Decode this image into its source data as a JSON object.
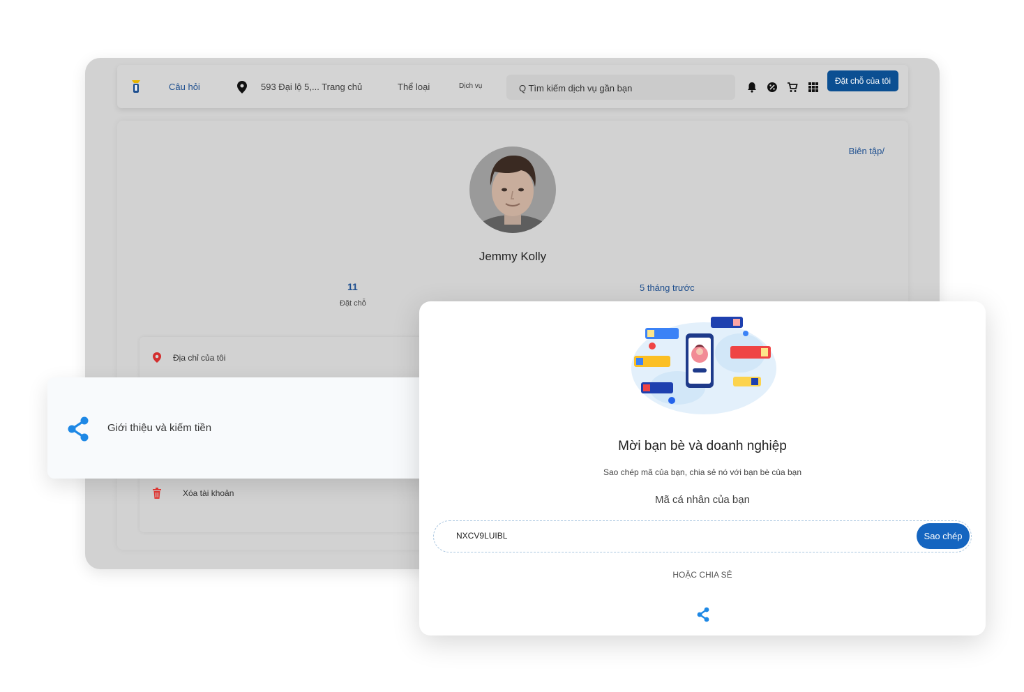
{
  "header": {
    "faq_link": "Câu hỏi",
    "address": "593 Đại lộ 5,... Trang chủ",
    "category_menu": "Thể loại",
    "service_menu": "Dịch vụ",
    "search_placeholder": "Q Tìm kiếm dịch vụ gần bạn",
    "my_bookings_button": "Đặt chỗ của tôi"
  },
  "profile": {
    "edit_link": "Biên tập/",
    "name": "Jemmy Kolly",
    "bookings_count": "11",
    "bookings_label": "Đặt chỗ",
    "member_since": "5 tháng trước"
  },
  "menu": {
    "my_address": "Địa chỉ của tôi",
    "referral": "Giới thiệu và kiếm tiền",
    "delete_account": "Xóa tài khoản"
  },
  "invite": {
    "title": "Mời bạn bè và doanh nghiệp",
    "subtitle": "Sao chép mã của bạn, chia sẻ nó với bạn bè của bạn",
    "code_label": "Mã cá nhân của bạn",
    "code_value": "NXCV9LUIBL",
    "copy_button": "Sao chép",
    "or_share": "HOẶC CHIA SẺ"
  },
  "colors": {
    "brand_blue": "#0b4f92",
    "button_blue": "#1565c0",
    "share_blue": "#1e88e5",
    "delete_red": "#e53935",
    "pin_red": "#d32f2f"
  },
  "icons": {
    "location": "map-pin-icon",
    "notifications": "bell-icon",
    "offers": "badge-icon",
    "cart": "cart-icon",
    "apps": "grid-icon",
    "share": "share-icon",
    "delete": "trash-icon"
  }
}
